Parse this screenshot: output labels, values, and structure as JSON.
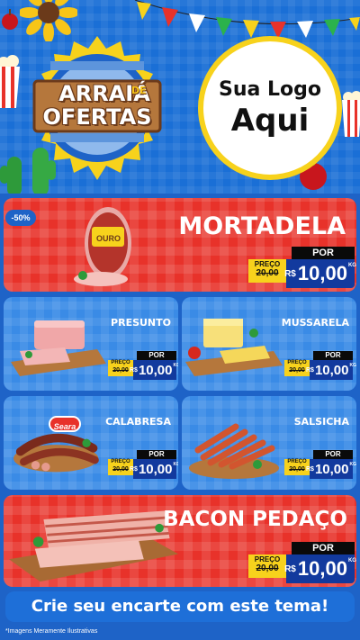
{
  "header": {
    "emblem_line1": "ARRAIÁ",
    "emblem_de": "DE",
    "emblem_line2": "OFERTAS",
    "logo_line1": "Sua Logo",
    "logo_line2": "Aqui"
  },
  "badge": "-50%",
  "products": {
    "mortadela": {
      "name": "MORTADELA",
      "brand": "OURO",
      "por": "POR",
      "preco": "PREÇO",
      "old": "20,00",
      "rs": "R$",
      "value": "10,00",
      "kg": "KG"
    },
    "presunto": {
      "name": "PRESUNTO",
      "por": "POR",
      "preco": "PREÇO",
      "old": "20,00",
      "rs": "R$",
      "value": "10,00",
      "kg": "KG"
    },
    "mussarela": {
      "name": "MUSSARELA",
      "por": "POR",
      "preco": "PREÇO",
      "old": "20,00",
      "rs": "R$",
      "value": "10,00",
      "kg": "KG"
    },
    "calabresa": {
      "name": "CALABRESA",
      "brand": "Seara",
      "por": "POR",
      "preco": "PREÇO",
      "old": "20,00",
      "rs": "R$",
      "value": "10,00",
      "kg": "KG"
    },
    "salsicha": {
      "name": "SALSICHA",
      "por": "POR",
      "preco": "PREÇO",
      "old": "20,00",
      "rs": "R$",
      "value": "10,00",
      "kg": "KG"
    },
    "bacon": {
      "name": "BACON PEDAÇO",
      "por": "POR",
      "preco": "PREÇO",
      "old": "20,00",
      "rs": "R$",
      "value": "10,00",
      "kg": "KG"
    }
  },
  "cta": "Crie seu encarte com este tema!",
  "disclaimer": "*Imagens Meramente Ilustrativas",
  "colors": {
    "red_card": "#e8322a",
    "blue_card": "#3a8be6",
    "price_blue": "#123a9e",
    "price_yellow": "#f7d21c",
    "background": "#1e63c7"
  }
}
